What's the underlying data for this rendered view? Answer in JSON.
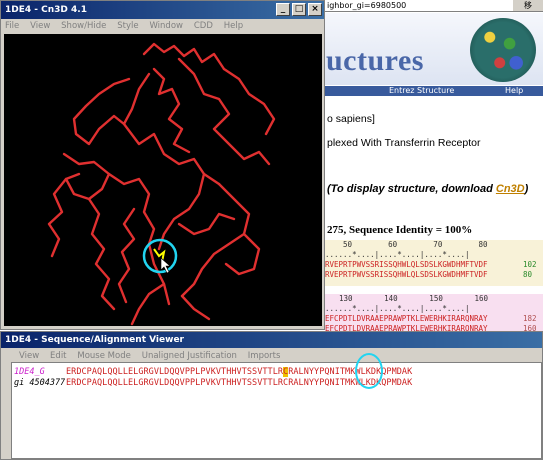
{
  "browser": {
    "address_text": "ighbor_gi=6980500",
    "go_label": "移",
    "banner_word": "uctures",
    "nav": {
      "entrez_structure": "Entrez Structure",
      "help": "Help"
    },
    "species_text": "o sapiens]",
    "description_text": "plexed With Transferrin Receptor",
    "download_note_prefix": "(To display structure, download ",
    "download_link": "Cn3D",
    "download_note_suffix": ")",
    "seq_header": "275, Sequence Identity = 100%",
    "block1": {
      "ruler_nums": "50        60        70        80",
      "ruler_marks": "......*....|....*....|....*....|",
      "row1": "RVEPRTPWVSSRISSQHWLQLSDSLKGWDHMFTVDF",
      "row1_num": "102",
      "row2": "RVEPRTPWVSSRISSQHWLQLSDSLKGWDHMFTVDF",
      "row2_num": "80"
    },
    "block2": {
      "ruler_nums": "130       140       150       160",
      "ruler_marks": "......*....|....*....|....*....|",
      "row1": "EFCPDTLDVRAAEPRAWPTKLEWERHKIRARQNRAY",
      "row1_num": "182",
      "row2": "EFCPDTLDVRAAEPRAWPTKLEWERHKIRARQNRAY",
      "row2_num": "160"
    }
  },
  "cn3d": {
    "title": "1DE4 - Cn3D 4.1",
    "menu": [
      "File",
      "View",
      "Show/Hide",
      "Style",
      "Window",
      "CDD",
      "Help"
    ],
    "window_buttons": [
      "_",
      "□",
      "×"
    ],
    "backbone_color": "#e03030",
    "highlight_color": "#22d4f0"
  },
  "seq_viewer": {
    "title": "1DE4 - Sequence/Alignment Viewer",
    "menu": [
      "View",
      "Edit",
      "Mouse Mode",
      "Unaligned Justification",
      "Imports"
    ],
    "rows": [
      {
        "name": "1DE4_G",
        "name_color": "#cc22cc",
        "seq_before": "ERDCPAQLQQLLELGRGVLDQQVPPLPVKVTHHVTSSVTTLR",
        "seq_hl": "C",
        "seq_after": "RALNYYPQNITMKWLKDKQPMDAK"
      },
      {
        "name": "gi 4504377",
        "name_color": "#000000",
        "seq_before": "ERDCPAQLQQLLELGRGVLDQQVPPLPVKVTHHVTSSVTTLR",
        "seq_hl": "C",
        "seq_after": "RALNYYPQNITMKWLKDKQPMDAK"
      }
    ]
  }
}
